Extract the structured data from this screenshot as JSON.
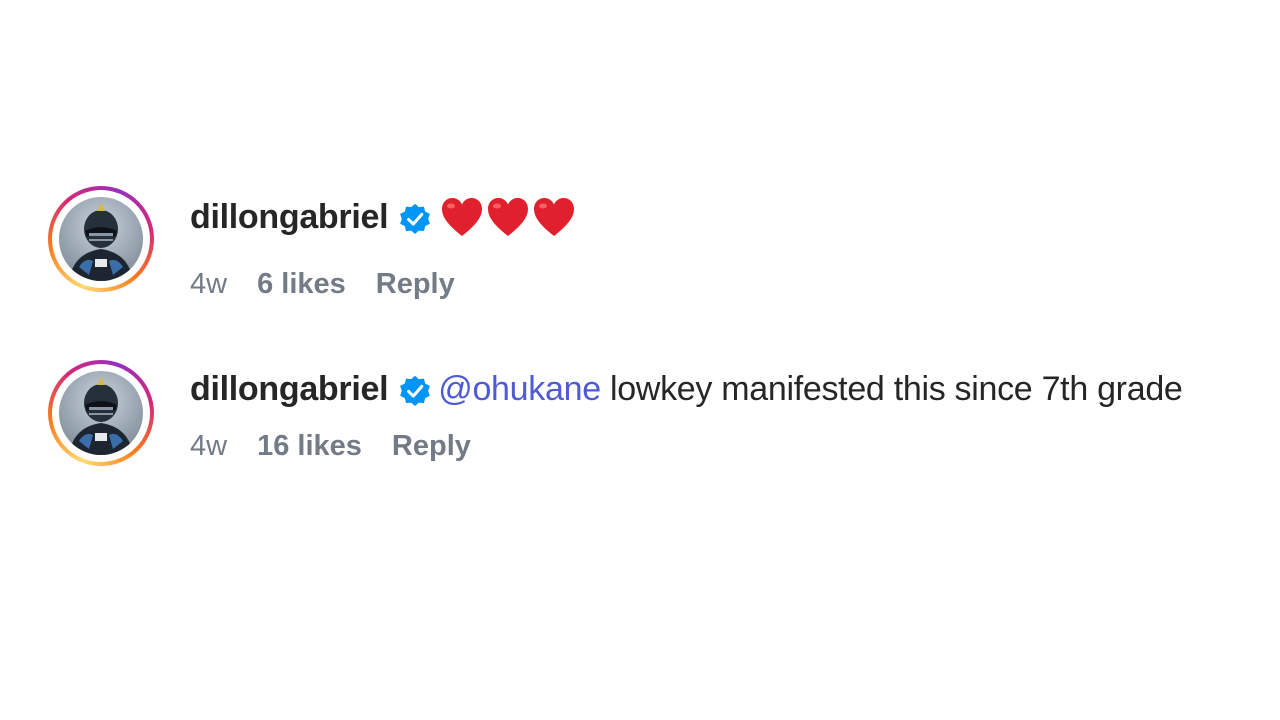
{
  "comments": [
    {
      "username": "dillongabriel",
      "verified": true,
      "text": "",
      "mention": "",
      "emoji": [
        "heart",
        "heart",
        "heart"
      ],
      "time": "4w",
      "likes": "6 likes",
      "reply": "Reply"
    },
    {
      "username": "dillongabriel",
      "verified": true,
      "mention": "@ohukane",
      "text": " lowkey manifested this since 7th grade",
      "time": "4w",
      "likes": "16 likes",
      "reply": "Reply"
    }
  ],
  "colors": {
    "verified": "#0095f6",
    "mention": "#4f5bd5",
    "meta": "#737b86",
    "heart": "#e0202c"
  },
  "icons": {
    "verified": "verified-badge-icon",
    "heart": "red-heart-emoji-icon"
  }
}
